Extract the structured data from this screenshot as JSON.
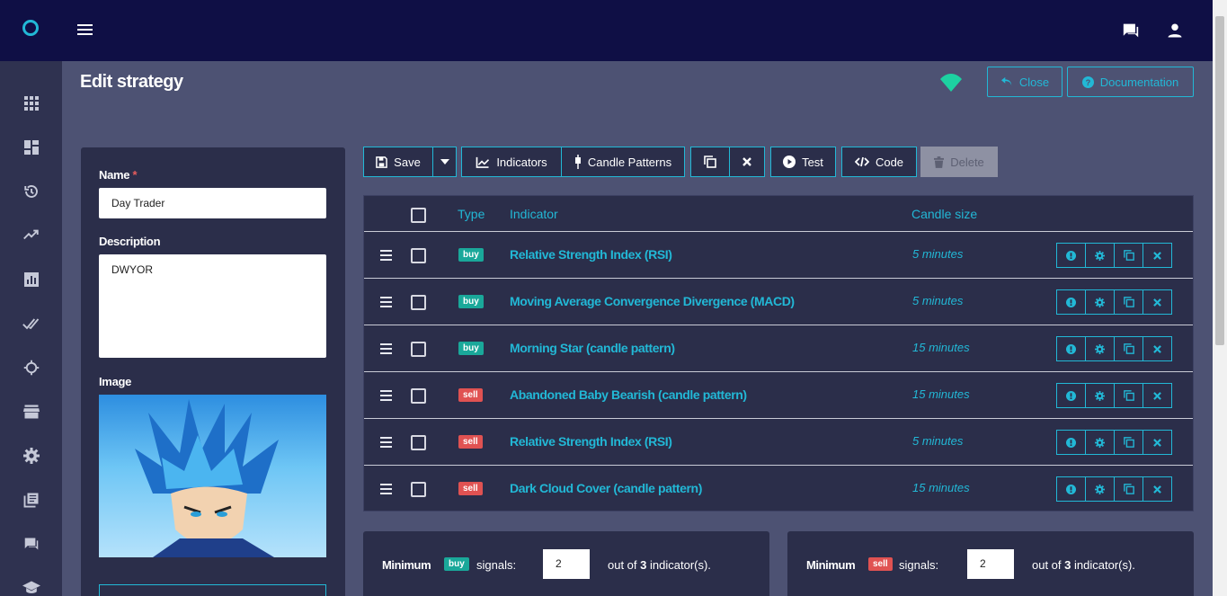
{
  "header": {
    "icons": [
      "logo-ring-icon",
      "menu-icon",
      "moon-icon",
      "chat-icon",
      "user-icon"
    ]
  },
  "sidebar": {
    "icons": [
      "apps-grid-icon",
      "dashboard-icon",
      "history-icon",
      "trending-up-icon",
      "bar-chart-icon",
      "double-check-icon",
      "crosshair-icon",
      "store-icon",
      "gear-icon",
      "library-books-icon",
      "forum-icon",
      "school-icon"
    ]
  },
  "page": {
    "title": "Edit strategy",
    "close_label": "Close",
    "docs_label": "Documentation",
    "status_color": "#1dd1a1"
  },
  "form": {
    "name_label": "Name",
    "name_required": "*",
    "name_value": "Day Trader",
    "description_label": "Description",
    "description_value": "DWYOR",
    "image_label": "Image"
  },
  "toolbar": {
    "save": "Save",
    "indicators": "Indicators",
    "candle_patterns": "Candle Patterns",
    "test": "Test",
    "code": "Code",
    "delete": "Delete"
  },
  "table": {
    "headers": {
      "type": "Type",
      "indicator": "Indicator",
      "candle_size": "Candle size"
    },
    "rows": [
      {
        "type": "buy",
        "indicator": "Relative Strength Index (RSI)",
        "candle": "5 minutes"
      },
      {
        "type": "buy",
        "indicator": "Moving Average Convergence Divergence (MACD)",
        "candle": "5 minutes"
      },
      {
        "type": "buy",
        "indicator": "Morning Star (candle pattern)",
        "candle": "15 minutes"
      },
      {
        "type": "sell",
        "indicator": "Abandoned Baby Bearish (candle pattern)",
        "candle": "15 minutes"
      },
      {
        "type": "sell",
        "indicator": "Relative Strength Index (RSI)",
        "candle": "5 minutes"
      },
      {
        "type": "sell",
        "indicator": "Dark Cloud Cover (candle pattern)",
        "candle": "15 minutes"
      }
    ]
  },
  "signals": {
    "buy": {
      "prefix": "Minimum",
      "badge": "buy",
      "suffix": "signals:",
      "value": "2",
      "out_of": "out of",
      "count": "3",
      "tail": "indicator(s)."
    },
    "sell": {
      "prefix": "Minimum",
      "badge": "sell",
      "suffix": "signals:",
      "value": "2",
      "out_of": "out of",
      "count": "3",
      "tail": "indicator(s)."
    }
  },
  "colors": {
    "accent": "#22b8d6",
    "buy": "#1aa89a",
    "sell": "#e05252",
    "topbar": "#0f0f45",
    "panel": "#2b2e4a"
  }
}
